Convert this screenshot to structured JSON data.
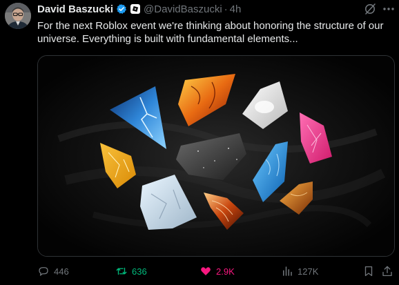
{
  "author": {
    "display_name": "David Baszucki",
    "handle": "@DavidBaszucki",
    "separator": "·",
    "time": "4h"
  },
  "tweet": {
    "text": "For the next Roblox event we're thinking about honoring the structure of our\nuniverse.  Everything is built with fundamental elements..."
  },
  "actions": {
    "replies": "446",
    "reposts": "636",
    "likes": "2.9K",
    "views": "127K"
  },
  "icons": {
    "verified": "verified-badge-icon",
    "affiliate": "roblox-affiliate-icon",
    "grok": "grok-icon",
    "more": "more-icon",
    "reply": "reply-icon",
    "repost": "repost-icon",
    "like": "heart-icon",
    "views": "views-icon",
    "bookmark": "bookmark-icon",
    "share": "share-icon"
  },
  "colors": {
    "verified": "#1d9bf0",
    "repost_active": "#00ba7c",
    "like_active": "#f91880",
    "muted": "#71767b",
    "text": "#e7e9ea"
  }
}
